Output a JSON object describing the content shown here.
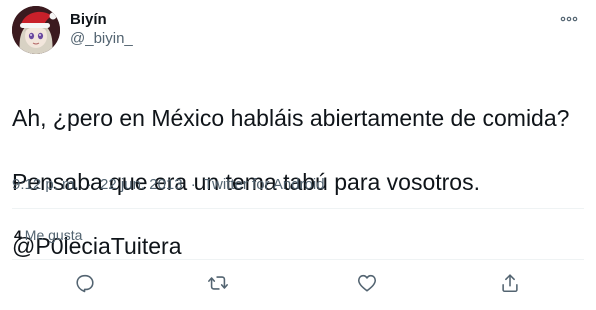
{
  "user": {
    "display_name": "Biyín",
    "handle": "@_biyin_",
    "avatar_icon": "avatar-santa-hat-character"
  },
  "tweet": {
    "text_lines": [
      "Ah, ¿pero en México habláis abiertamente de comida?",
      "Pensaba que era un tema tabú para vosotros.",
      "@P0leciaTuitera"
    ],
    "time": "9:12 p. m.",
    "date": "22 jun. 2013",
    "separator": "·",
    "source": "Twitter for Android"
  },
  "stats": {
    "likes_count": "4",
    "likes_label": "Me gusta"
  },
  "actions": [
    {
      "icon": "reply-icon"
    },
    {
      "icon": "retweet-icon"
    },
    {
      "icon": "like-icon"
    },
    {
      "icon": "share-icon"
    }
  ],
  "colors": {
    "text_primary": "#0f1419",
    "text_secondary": "#536471",
    "divider": "#eff3f4",
    "icon": "#536471"
  }
}
